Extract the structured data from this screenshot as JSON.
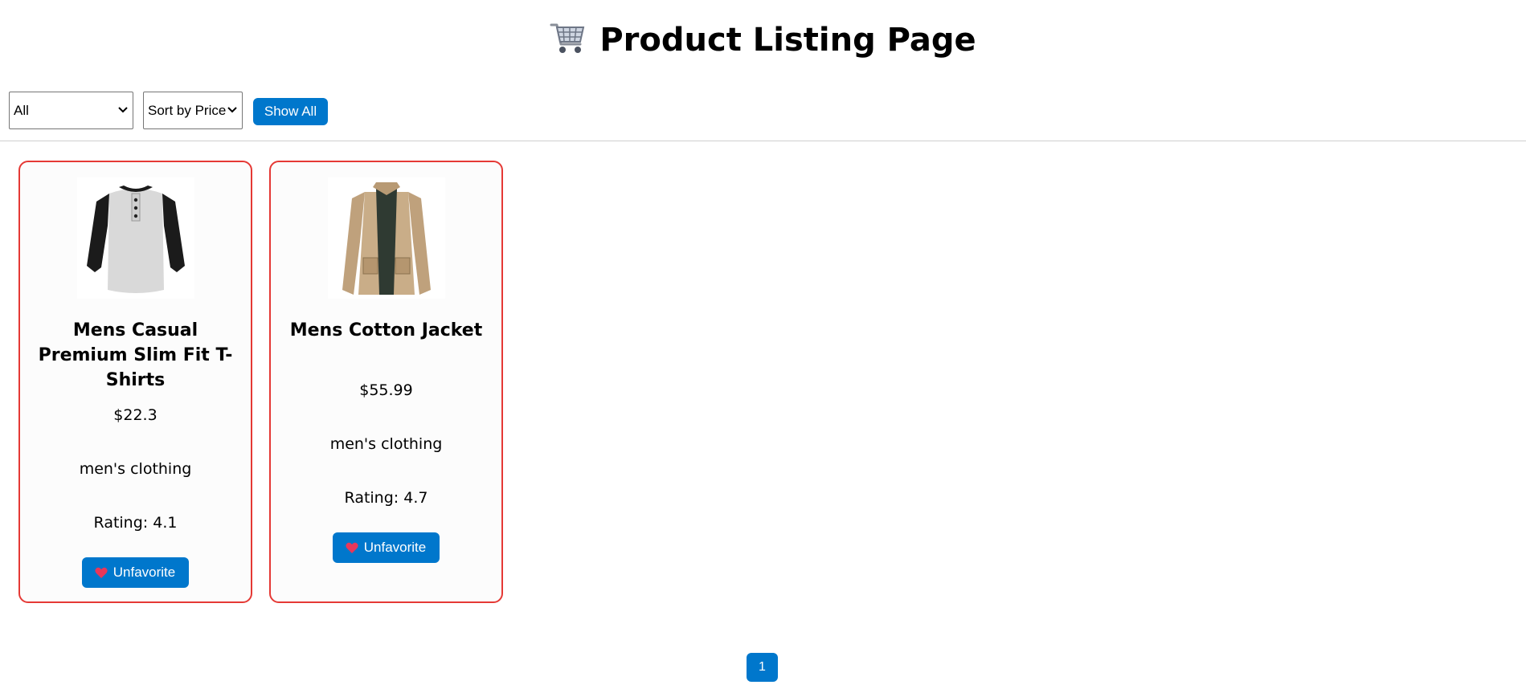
{
  "header": {
    "title": "Product Listing Page",
    "icon": "shopping-cart-icon"
  },
  "filters": {
    "category": {
      "selected": "All"
    },
    "sort": {
      "selected": "Sort by Price"
    },
    "show_all_label": "Show All"
  },
  "products": [
    {
      "name": "Mens Casual Premium Slim Fit T-Shirts",
      "price": "$22.3",
      "category": "men's clothing",
      "rating": "Rating: 4.1",
      "favorite_label": "Unfavorite",
      "image": "raglan-henley-shirt-image"
    },
    {
      "name": "Mens Cotton Jacket",
      "price": "$55.99",
      "category": "men's clothing",
      "rating": "Rating: 4.7",
      "favorite_label": "Unfavorite",
      "image": "khaki-cotton-jacket-image"
    }
  ],
  "pagination": {
    "pages": [
      "1"
    ],
    "current": "1"
  },
  "colors": {
    "accent": "#0077cc",
    "card_border": "#e53935",
    "heart": "#e8375a"
  }
}
